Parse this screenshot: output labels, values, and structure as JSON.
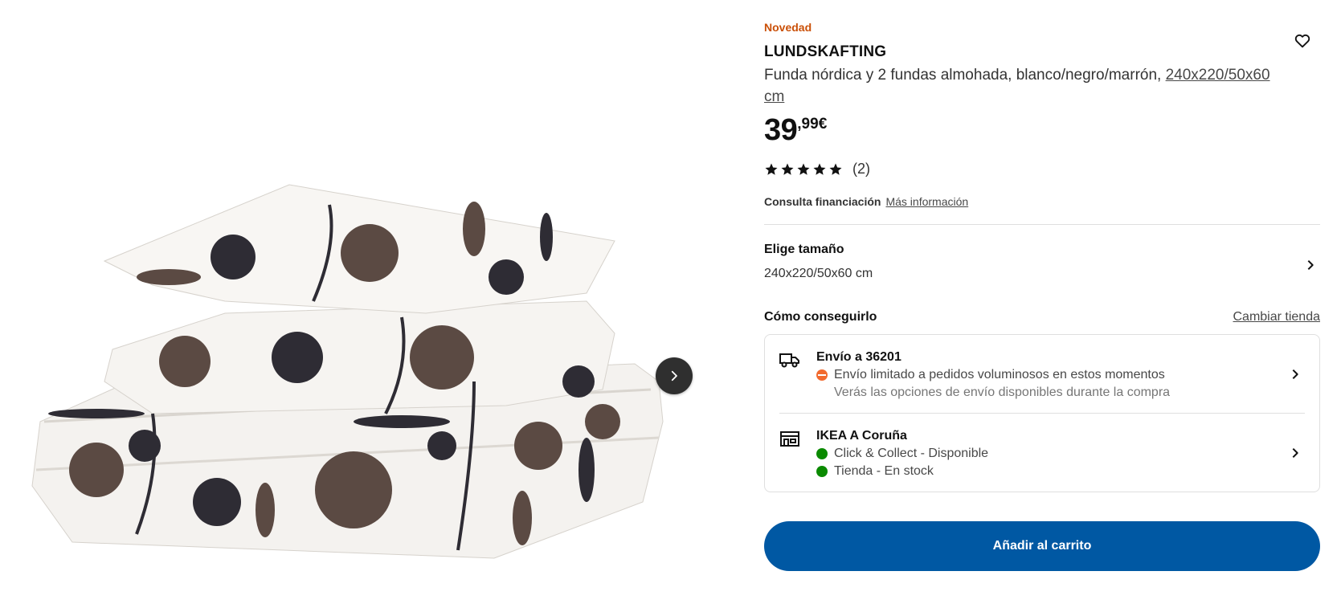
{
  "product": {
    "badge": "Novedad",
    "name": "LUNDSKAFTING",
    "description": "Funda nórdica y 2 fundas almohada, blanco/negro/marrón, ",
    "size_link": "240x220/50x60 cm",
    "price_integer": "39",
    "price_decimal": ",99€",
    "rating": {
      "stars": 5,
      "max": 5,
      "count_label": "(2)"
    },
    "image_icon": "duvet-cover-set-image"
  },
  "finance": {
    "label": "Consulta financiación",
    "link": "Más información"
  },
  "size_selector": {
    "title": "Elige tamaño",
    "value": "240x220/50x60 cm"
  },
  "how_to_get": {
    "title": "Cómo conseguirlo",
    "change_store": "Cambiar tienda"
  },
  "delivery": {
    "title": "Envío a 36201",
    "status": "Envío limitado a pedidos voluminosos en estos momentos",
    "note": "Verás las opciones de envío disponibles durante la compra",
    "icon": "truck-icon",
    "status_color": "#f26a2e"
  },
  "store": {
    "title": "IKEA A Coruña",
    "click_collect": "Click & Collect - Disponible",
    "in_store": "Tienda - En stock",
    "icon": "store-icon",
    "status_color": "#0a8a00"
  },
  "cart_button": "Añadir al carrito",
  "colors": {
    "accent": "#0058a3",
    "badge": "#ca5008"
  }
}
